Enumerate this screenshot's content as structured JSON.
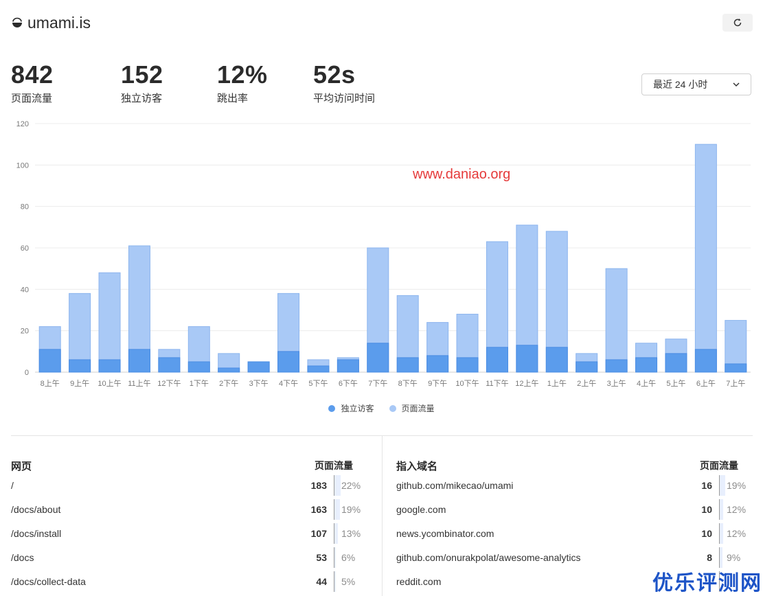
{
  "header": {
    "site_name": "umami.is",
    "logo_icon": "umami-logo-icon",
    "refresh_icon": "refresh-icon"
  },
  "metrics": [
    {
      "value": "842",
      "label": "页面流量"
    },
    {
      "value": "152",
      "label": "独立访客"
    },
    {
      "value": "12%",
      "label": "跳出率"
    },
    {
      "value": "52s",
      "label": "平均访问时间"
    }
  ],
  "date_range": {
    "selected": "最近 24 小时",
    "icon": "chevron-down-icon"
  },
  "chart_data": {
    "type": "bar",
    "stacked": "overlapped",
    "categories": [
      "8上午",
      "9上午",
      "10上午",
      "11上午",
      "12下午",
      "1下午",
      "2下午",
      "3下午",
      "4下午",
      "5下午",
      "6下午",
      "7下午",
      "8下午",
      "9下午",
      "10下午",
      "11下午",
      "12上午",
      "1上午",
      "2上午",
      "3上午",
      "4上午",
      "5上午",
      "6上午",
      "7上午"
    ],
    "series": [
      {
        "name": "独立访客",
        "color": "#5b9cec",
        "values": [
          11,
          6,
          6,
          11,
          7,
          5,
          2,
          5,
          10,
          3,
          6,
          14,
          7,
          8,
          7,
          12,
          13,
          12,
          5,
          6,
          7,
          9,
          11,
          4
        ]
      },
      {
        "name": "页面流量",
        "color": "#a9c9f6",
        "values": [
          22,
          38,
          48,
          61,
          11,
          22,
          9,
          5,
          38,
          6,
          7,
          60,
          37,
          24,
          28,
          63,
          71,
          68,
          9,
          50,
          14,
          16,
          110,
          25
        ]
      }
    ],
    "yticks": [
      0,
      20,
      40,
      60,
      80,
      100,
      120
    ],
    "ylim": [
      0,
      120
    ],
    "grid": true,
    "legend": "bottom-center"
  },
  "pages_panel": {
    "title": "网页",
    "metric_label": "页面流量",
    "rows": [
      {
        "path": "/",
        "views": "183",
        "percent": "22%",
        "share": 0.22
      },
      {
        "path": "/docs/about",
        "views": "163",
        "percent": "19%",
        "share": 0.19
      },
      {
        "path": "/docs/install",
        "views": "107",
        "percent": "13%",
        "share": 0.13
      },
      {
        "path": "/docs",
        "views": "53",
        "percent": "6%",
        "share": 0.06
      },
      {
        "path": "/docs/collect-data",
        "views": "44",
        "percent": "5%",
        "share": 0.05
      }
    ]
  },
  "referrers_panel": {
    "title": "指入域名",
    "metric_label": "页面流量",
    "rows": [
      {
        "path": "github.com/mikecao/umami",
        "views": "16",
        "percent": "19%",
        "share": 0.19
      },
      {
        "path": "google.com",
        "views": "10",
        "percent": "12%",
        "share": 0.12
      },
      {
        "path": "news.ycombinator.com",
        "views": "10",
        "percent": "12%",
        "share": 0.12
      },
      {
        "path": "github.com/onurakpolat/awesome-analytics",
        "views": "8",
        "percent": "9%",
        "share": 0.09
      },
      {
        "path": "reddit.com",
        "views": "",
        "percent": "",
        "share": 0
      }
    ]
  },
  "watermarks": {
    "site": "www.daniao.org",
    "brand": "优乐评测网"
  }
}
